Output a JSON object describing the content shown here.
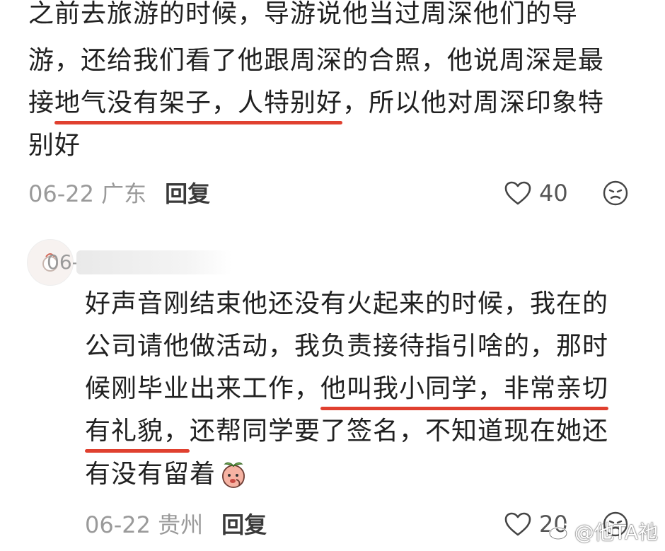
{
  "comment1": {
    "lines": [
      "之前去旅游的时候，导游说他当过周深他们的导",
      "游，还给我们看了他跟周深的合照，他说周深是最"
    ],
    "line3": {
      "before": "接",
      "highlight": "地气没有架子，人特别好",
      "after": "，所以他对周深印象特"
    },
    "line4": "别好",
    "date_location": "06-22 广东",
    "reply": "回复",
    "likes": "40"
  },
  "comment2": {
    "username": "06-",
    "line1": "好声音刚结束他还没有火起来的时候，我在的",
    "line2": "公司请他做活动，我负责接待指引啥的，那时",
    "line3": {
      "before": "候刚毕业出来工作，",
      "highlight": "他叫我小同学，非常亲切"
    },
    "line4": {
      "highlight": "有礼貌，",
      "after": "还帮同学要了签名，不知道现在她还"
    },
    "line5": "有没有留着",
    "date_location": "06-22 贵州",
    "reply": "回复",
    "likes": "20"
  },
  "watermark": "@他TA祂",
  "colors": {
    "highlight": "#e0402f",
    "meta": "#9a9a9a"
  },
  "icons": [
    "heart-icon",
    "face-emoji-icon",
    "peach-emoji-icon",
    "weibo-icon"
  ]
}
